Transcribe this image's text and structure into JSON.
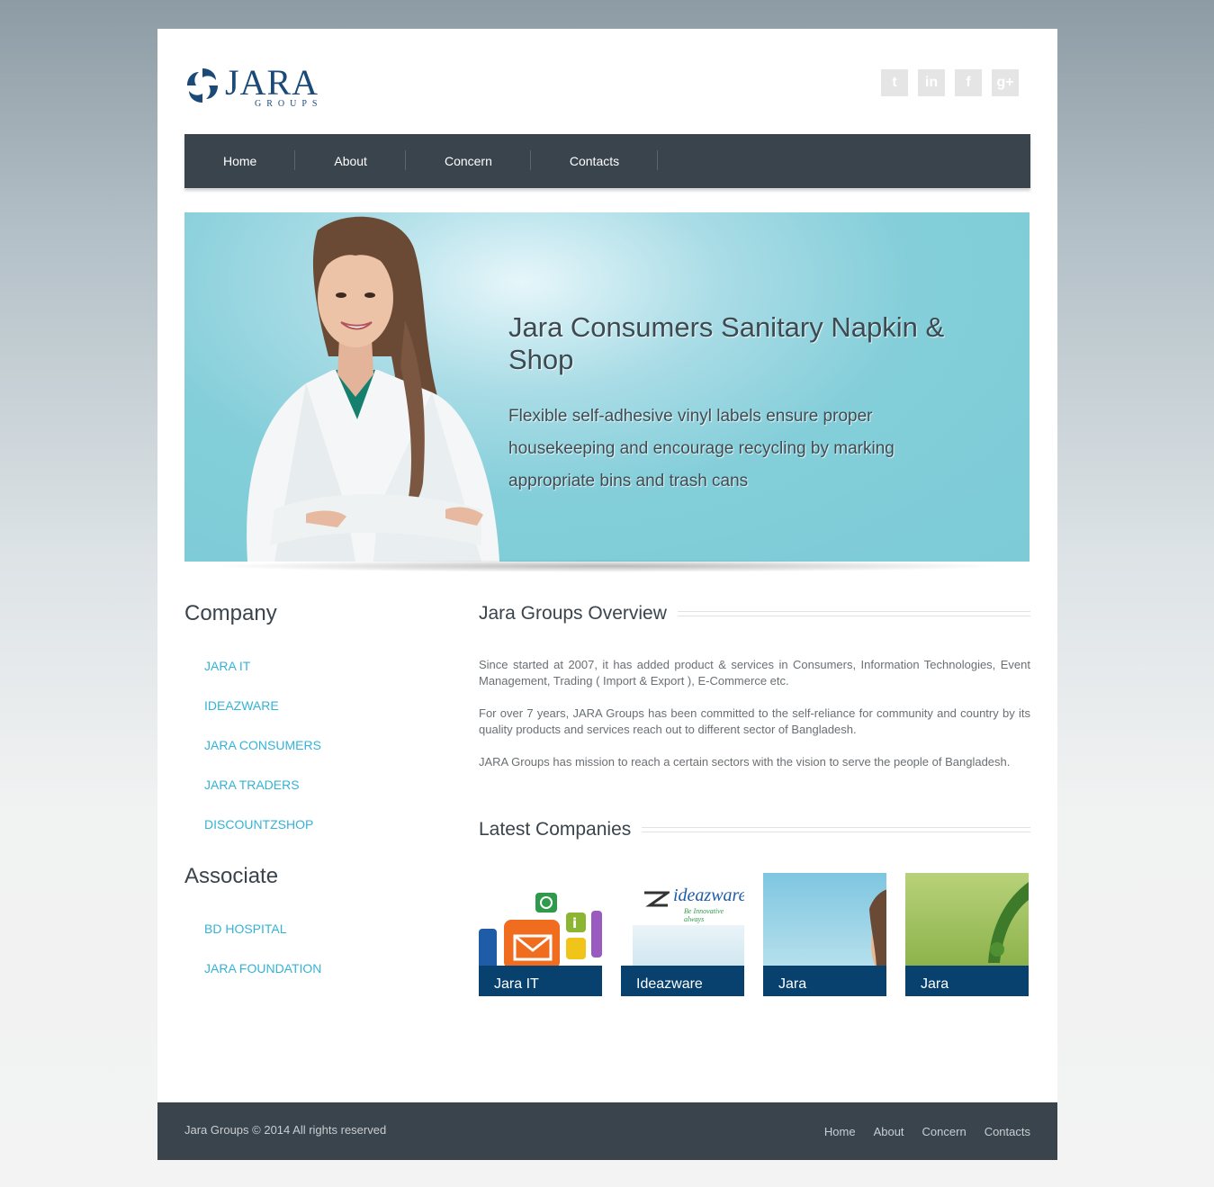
{
  "brand": {
    "name": "JARA",
    "sub": "GROUPS"
  },
  "social": [
    {
      "icon": "twitter-icon",
      "glyph": "t"
    },
    {
      "icon": "linkedin-icon",
      "glyph": "in"
    },
    {
      "icon": "facebook-icon",
      "glyph": "f"
    },
    {
      "icon": "google-plus-icon",
      "glyph": "g+"
    }
  ],
  "nav": [
    "Home",
    "About",
    "Concern",
    "Contacts"
  ],
  "hero": {
    "title": "Jara Consumers Sanitary Napkin & Shop",
    "description": "Flexible self-adhesive vinyl labels ensure proper housekeeping and encourage recycling by marking appropriate bins and trash cans"
  },
  "sidebar": {
    "company_heading": "Company",
    "company_items": [
      "JARA IT",
      "IDEAZWARE",
      "JARA CONSUMERS",
      "JARA TRADERS",
      "DISCOUNTZSHOP"
    ],
    "associate_heading": "Associate",
    "associate_items": [
      "BD HOSPITAL",
      "JARA FOUNDATION"
    ]
  },
  "overview": {
    "heading": "Jara Groups Overview",
    "paragraphs": [
      "Since started at 2007, it has added product & services in Consumers, Information Technologies, Event Management, Trading ( Import & Export ), E-Commerce etc.",
      "For over 7 years, JARA Groups has been committed to the self-reliance for community and country by its quality products and services reach out to different sector of Bangladesh.",
      "JARA Groups has mission to reach a certain sectors with the vision to serve the people of Bangladesh."
    ]
  },
  "latest": {
    "heading": "Latest Companies",
    "cards": [
      {
        "caption": "Jara IT"
      },
      {
        "caption": "Ideazware",
        "logo_text": "ideazware",
        "tagline": "Be Innovative always"
      },
      {
        "caption": "Jara"
      },
      {
        "caption": "Jara"
      }
    ]
  },
  "footer": {
    "copyright": "Jara Groups © 2014 All rights reserved",
    "links": [
      "Home",
      "About",
      "Concern",
      "Contacts"
    ]
  },
  "colors": {
    "nav_bg": "#3a444c",
    "link": "#35b3d6",
    "caption_bg": "#08416e",
    "brand": "#1b4a78"
  }
}
